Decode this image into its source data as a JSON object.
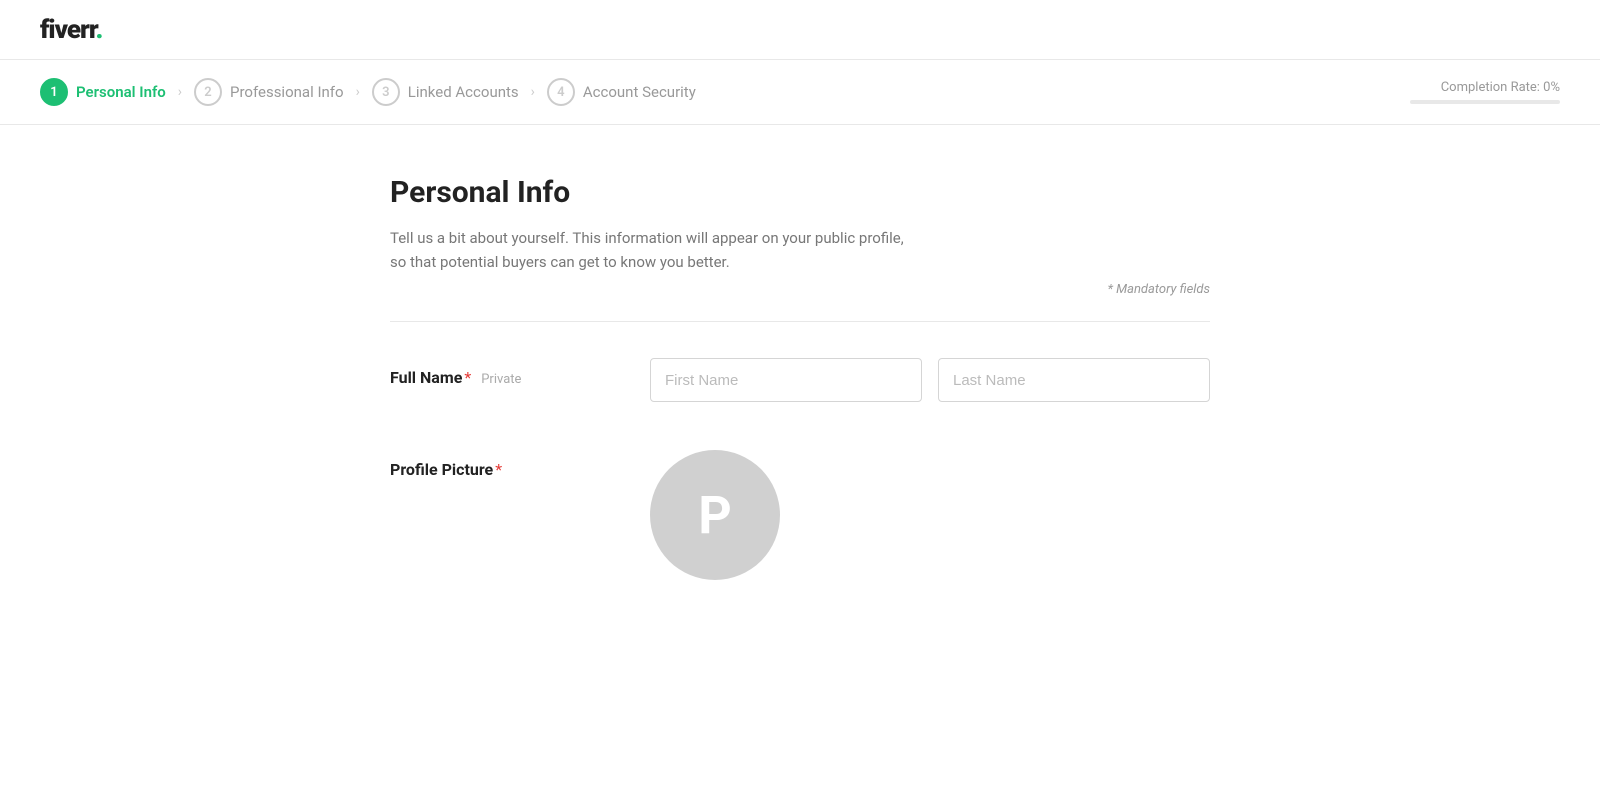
{
  "header": {
    "logo_text": "fiverr",
    "logo_dot": "."
  },
  "stepper": {
    "steps": [
      {
        "number": "1",
        "label": "Personal Info",
        "active": true
      },
      {
        "number": "2",
        "label": "Professional Info",
        "active": false
      },
      {
        "number": "3",
        "label": "Linked Accounts",
        "active": false
      },
      {
        "number": "4",
        "label": "Account Security",
        "active": false
      }
    ],
    "completion_label": "Completion Rate: 0%",
    "completion_percent": 0
  },
  "page": {
    "title": "Personal Info",
    "description": "Tell us a bit about yourself. This information will appear on your public profile, so that potential buyers can get to know you better.",
    "mandatory_note": "* Mandatory fields"
  },
  "form": {
    "full_name_label": "Full Name",
    "full_name_private": "Private",
    "first_name_placeholder": "First Name",
    "last_name_placeholder": "Last Name",
    "profile_picture_label": "Profile Picture",
    "avatar_letter": "P"
  }
}
